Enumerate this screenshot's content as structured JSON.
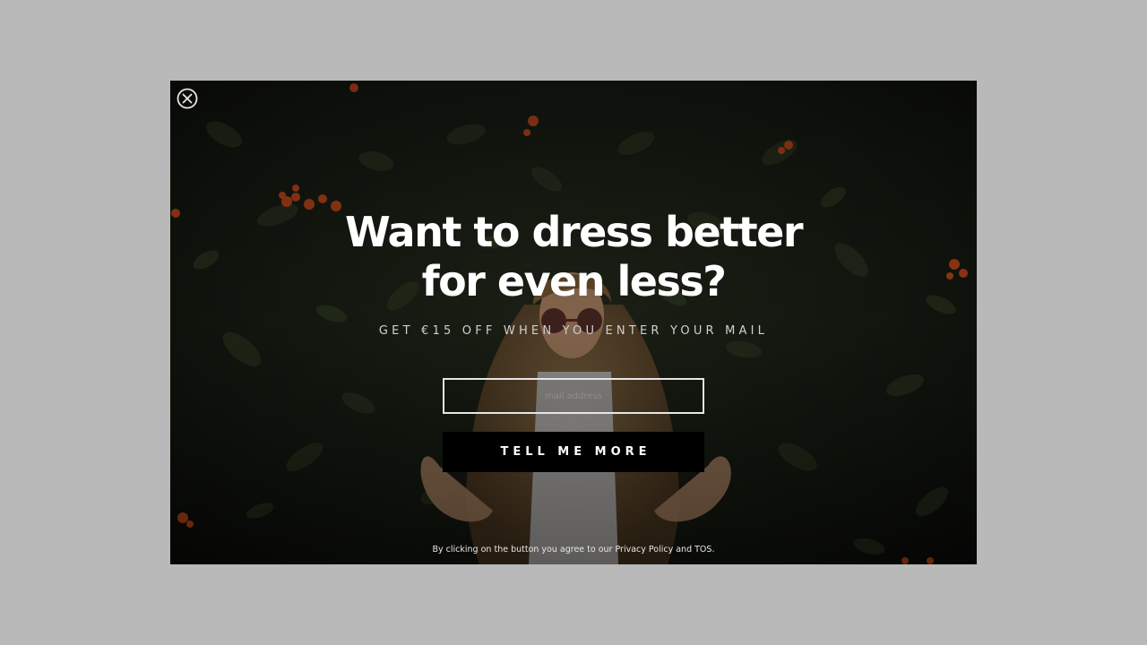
{
  "popup": {
    "headline_line1": "Want to dress better",
    "headline_line2": "for even less?",
    "subheadline": "GET €15 OFF WHEN YOU ENTER YOUR MAIL",
    "email_placeholder": "mail address",
    "submit_label": "TELL ME MORE",
    "disclaimer": "By clicking on the button you agree to our Privacy Policy and TOS.",
    "close_icon": "close-circle-icon"
  },
  "colors": {
    "overlay": "#b9b9b9",
    "headline": "#ffffff",
    "button_bg": "#000000",
    "button_text": "#ffffff",
    "input_border": "#e6e6e6",
    "flower_accent": "#d8501e"
  }
}
